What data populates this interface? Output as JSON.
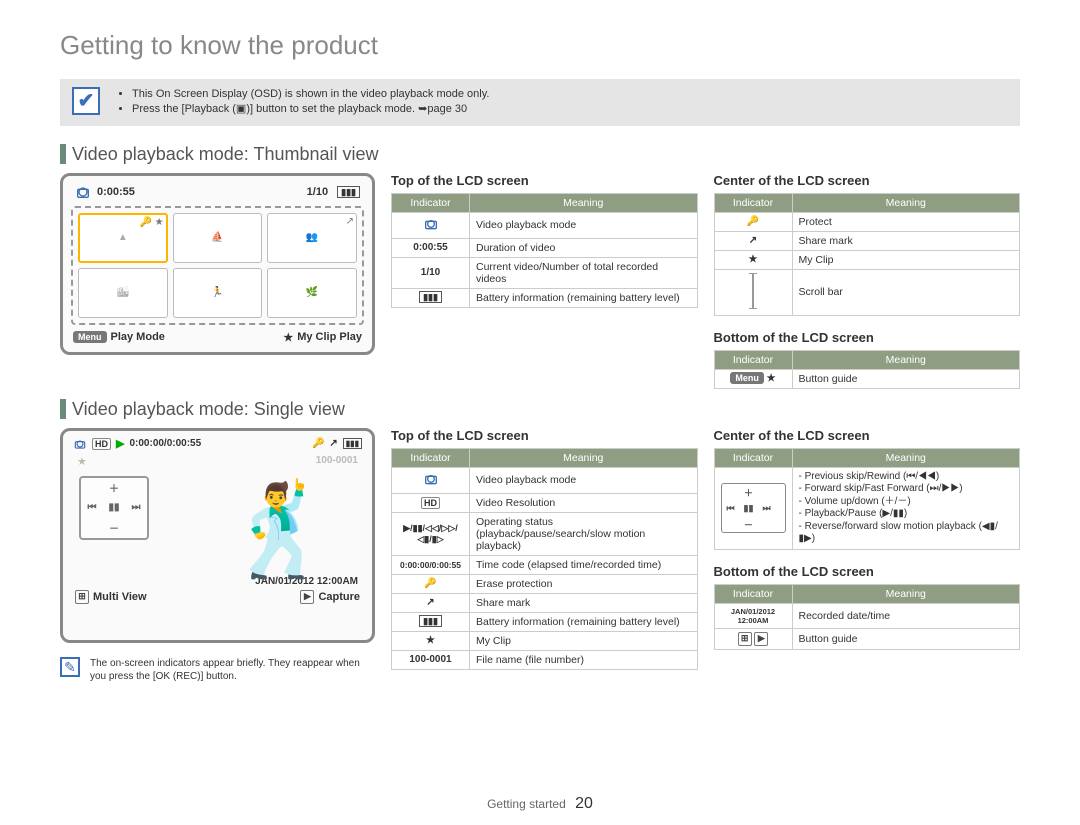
{
  "page_title": "Getting to know the product",
  "note": {
    "items": [
      "This On Screen Display (OSD) is shown in the video playback mode only.",
      "Press the [Playback (▣)] button to set the playback mode. ➥page 30"
    ]
  },
  "section1": {
    "heading": "Video playback mode: Thumbnail view",
    "device": {
      "duration": "0:00:55",
      "count": "1/10",
      "bottom_left_chip": "Menu",
      "bottom_left": "Play Mode",
      "bottom_right": "My Clip Play"
    },
    "top_table": {
      "title": "Top of the LCD screen",
      "headers": [
        "Indicator",
        "Meaning"
      ],
      "rows": [
        {
          "ind": "icon-camera",
          "meaning": "Video playback mode"
        },
        {
          "ind": "0:00:55",
          "meaning": "Duration of video"
        },
        {
          "ind": "1/10",
          "meaning": "Current video/Number of total recorded videos"
        },
        {
          "ind": "icon-battery",
          "meaning": "Battery information (remaining battery level)"
        }
      ]
    },
    "center_table": {
      "title": "Center of the LCD screen",
      "headers": [
        "Indicator",
        "Meaning"
      ],
      "rows": [
        {
          "ind": "icon-key",
          "meaning": "Protect"
        },
        {
          "ind": "icon-share",
          "meaning": "Share mark"
        },
        {
          "ind": "icon-star",
          "meaning": "My Clip"
        },
        {
          "ind": "icon-scroll",
          "meaning": "Scroll bar"
        }
      ]
    },
    "bottom_table": {
      "title": "Bottom of the LCD screen",
      "headers": [
        "Indicator",
        "Meaning"
      ],
      "rows": [
        {
          "ind": "icon-menu-star",
          "meaning": "Button guide"
        }
      ]
    }
  },
  "section2": {
    "heading": "Video playback mode: Single view",
    "device": {
      "time": "0:00:00/0:00:55",
      "file": "100-0001",
      "date": "JAN/01/2012 12:00AM",
      "bottom_left": "Multi View",
      "bottom_right": "Capture"
    },
    "after_note": "The on-screen indicators appear briefly. They reappear when you press the [OK (REC)] button.",
    "top_table": {
      "title": "Top of the LCD screen",
      "headers": [
        "Indicator",
        "Meaning"
      ],
      "rows": [
        {
          "ind": "icon-camera",
          "meaning": "Video playback mode"
        },
        {
          "ind": "icon-hd",
          "meaning": "Video Resolution"
        },
        {
          "ind": "▶/▮▮/◁◁/▷▷/◁▮/▮▷",
          "meaning": "Operating status (playback/pause/search/slow motion playback)"
        },
        {
          "ind": "0:00:00/0:00:55",
          "meaning": "Time code (elapsed time/recorded time)"
        },
        {
          "ind": "icon-key",
          "meaning": "Erase protection"
        },
        {
          "ind": "icon-share",
          "meaning": "Share mark"
        },
        {
          "ind": "icon-battery",
          "meaning": "Battery information (remaining battery level)"
        },
        {
          "ind": "icon-star",
          "meaning": "My Clip"
        },
        {
          "ind": "100-0001",
          "meaning": "File name (file number)"
        }
      ]
    },
    "center_table": {
      "title": "Center of the LCD screen",
      "headers": [
        "Indicator",
        "Meaning"
      ],
      "rows_cluster_meaning": [
        "- Previous skip/Rewind (⏮/◀◀)",
        "- Forward skip/Fast Forward (⏭/▶▶)",
        "- Volume up/down (＋/－)",
        "- Playback/Pause (▶/▮▮)",
        "- Reverse/forward slow motion playback (◀▮/▮▶)"
      ]
    },
    "bottom_table": {
      "title": "Bottom of the LCD screen",
      "headers": [
        "Indicator",
        "Meaning"
      ],
      "rows": [
        {
          "ind": "JAN/01/2012 12:00AM",
          "meaning": "Recorded date/time"
        },
        {
          "ind": "icon-multi-capture",
          "meaning": "Button guide"
        }
      ]
    }
  },
  "footer": {
    "label": "Getting started",
    "page": "20"
  }
}
